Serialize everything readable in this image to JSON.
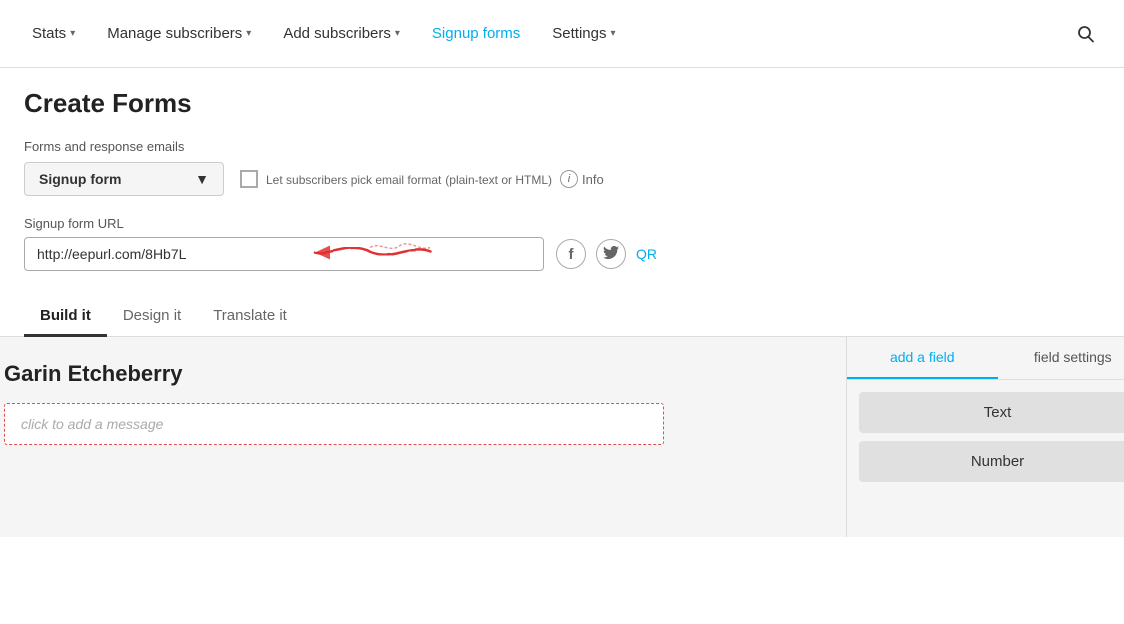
{
  "nav": {
    "items": [
      {
        "id": "stats",
        "label": "Stats",
        "hasDropdown": true,
        "active": false
      },
      {
        "id": "manage-subscribers",
        "label": "Manage subscribers",
        "hasDropdown": true,
        "active": false
      },
      {
        "id": "add-subscribers",
        "label": "Add subscribers",
        "hasDropdown": true,
        "active": false
      },
      {
        "id": "signup-forms",
        "label": "Signup forms",
        "hasDropdown": false,
        "active": true
      },
      {
        "id": "settings",
        "label": "Settings",
        "hasDropdown": true,
        "active": false
      }
    ],
    "search_icon": "🔍"
  },
  "page": {
    "title": "Create Forms"
  },
  "forms_section": {
    "label": "Forms and response emails",
    "dropdown_value": "Signup form",
    "dropdown_chevron": "▼",
    "checkbox_label": "Let subscribers pick email format",
    "checkbox_sublabel": "(plain-text or HTML)",
    "info_label": "Info"
  },
  "url_section": {
    "label": "Signup form URL",
    "url_value": "http://eepurl.com/8Hb7L",
    "facebook_icon": "f",
    "twitter_icon": "🐦",
    "qr_label": "QR"
  },
  "tabs": [
    {
      "id": "build-it",
      "label": "Build it",
      "active": true
    },
    {
      "id": "design-it",
      "label": "Design it",
      "active": false
    },
    {
      "id": "translate-it",
      "label": "Translate it",
      "active": false
    }
  ],
  "preview": {
    "title": "Garin Etcheberry",
    "message_placeholder": "click to add a message"
  },
  "right_panel": {
    "tabs": [
      {
        "id": "add-a-field",
        "label": "add a field",
        "active": true
      },
      {
        "id": "field-settings",
        "label": "field settings",
        "active": false
      }
    ],
    "buttons": [
      {
        "id": "text-btn",
        "label": "Text"
      },
      {
        "id": "number-btn",
        "label": "Number"
      }
    ]
  }
}
